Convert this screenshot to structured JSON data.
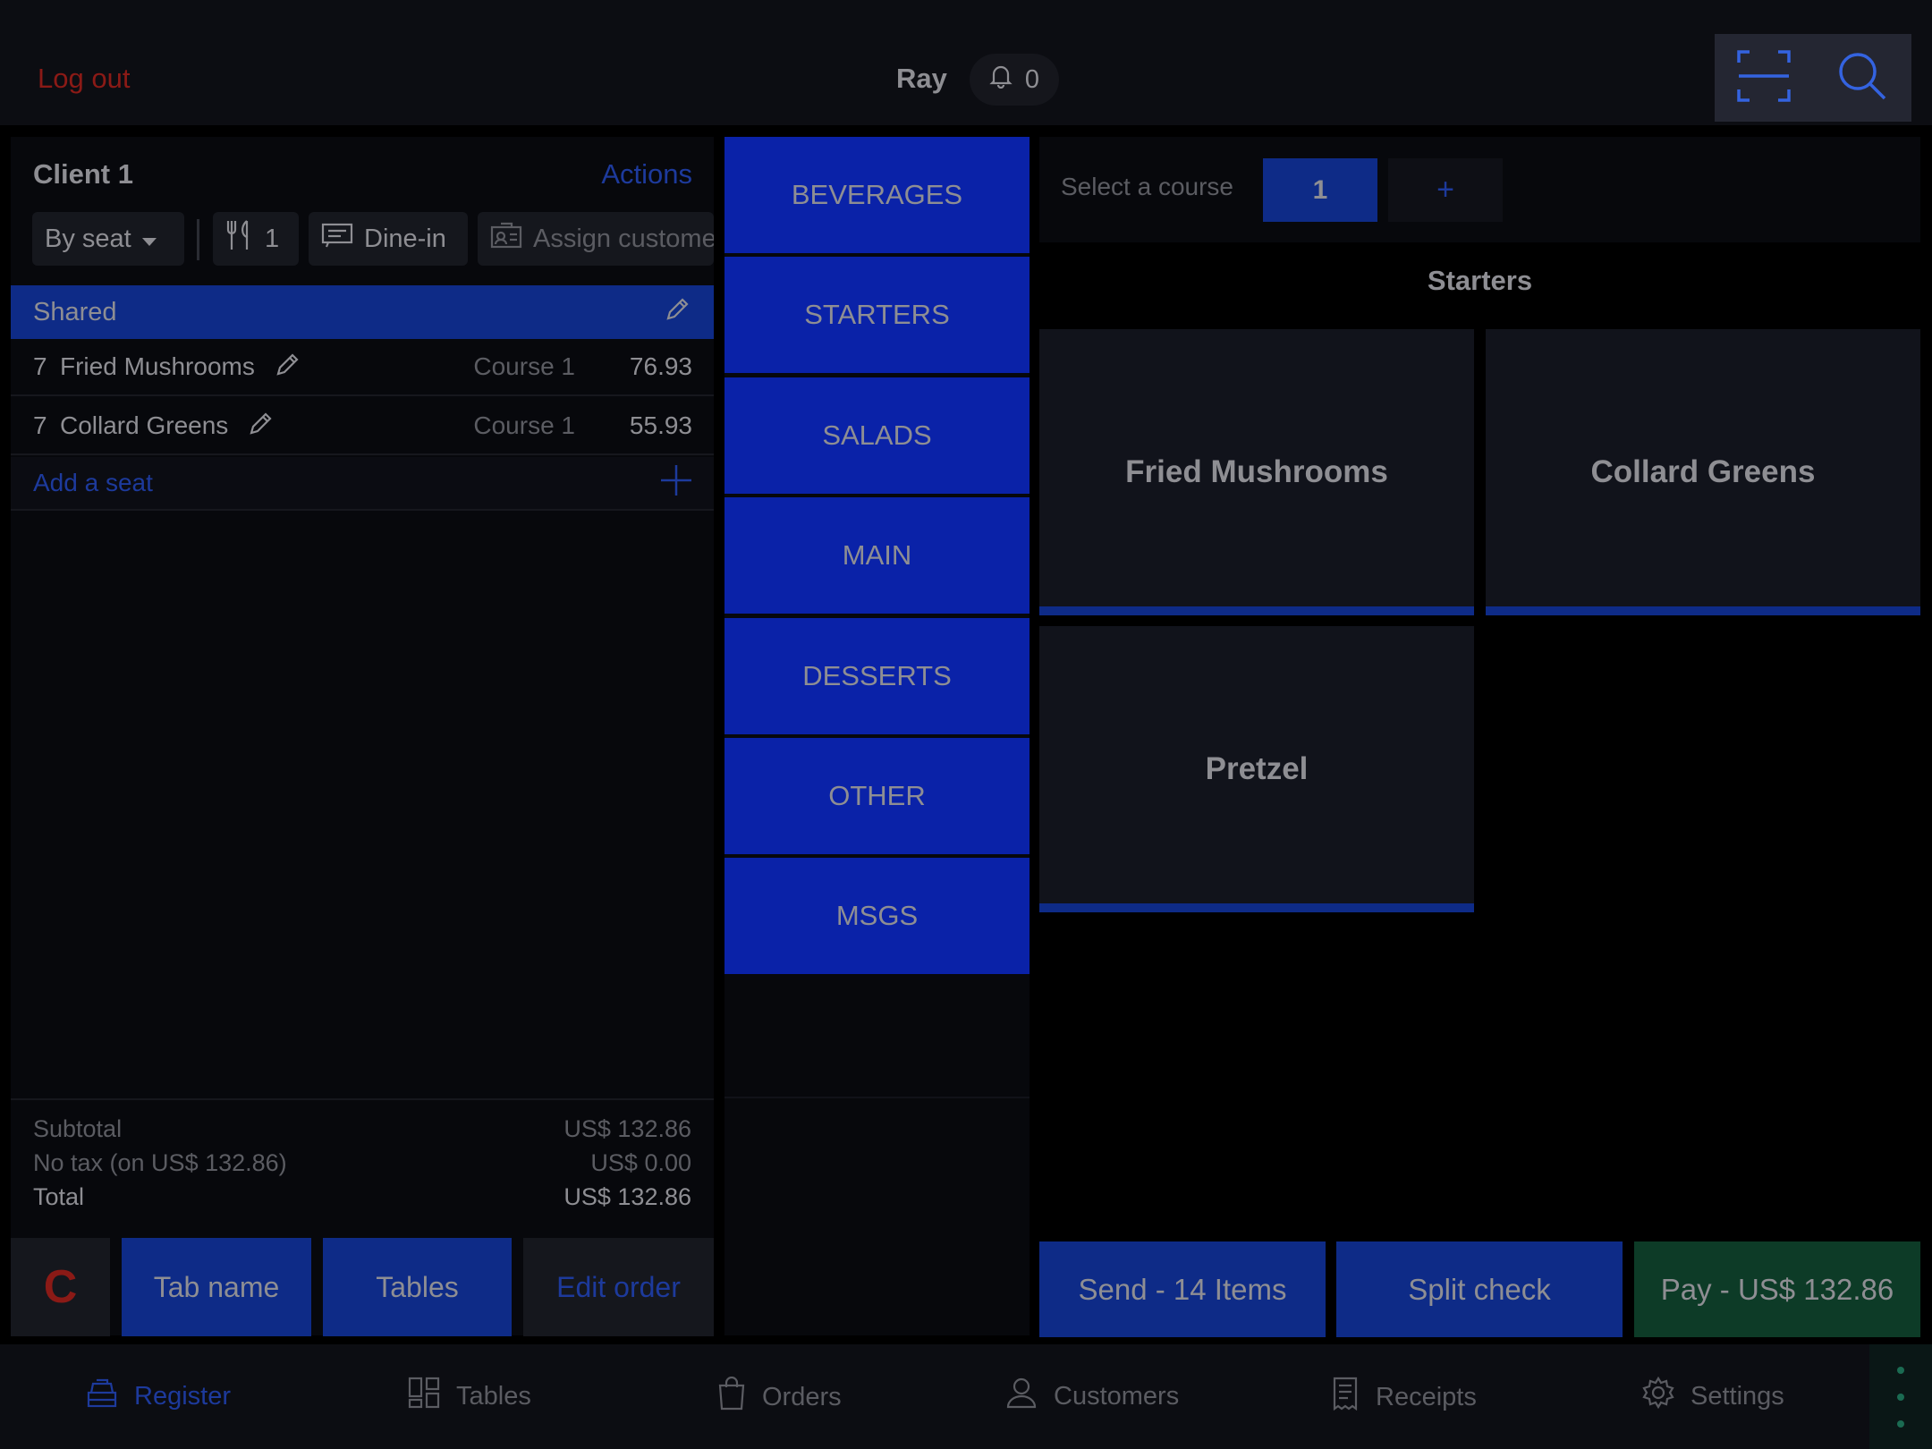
{
  "header": {
    "logout_label": "Log out",
    "user_name": "Ray",
    "notification_count": "0"
  },
  "order": {
    "client_title": "Client 1",
    "actions_label": "Actions",
    "mode_label": "By seat",
    "guests_count": "1",
    "dining_option": "Dine-in",
    "assign_customer_label": "Assign customer",
    "shared_label": "Shared",
    "items": [
      {
        "qty": "7",
        "name": "Fried Mushrooms",
        "course": "Course 1",
        "price": "76.93"
      },
      {
        "qty": "7",
        "name": "Collard Greens",
        "course": "Course 1",
        "price": "55.93"
      }
    ],
    "add_seat_label": "Add a seat"
  },
  "totals": {
    "subtotal_label": "Subtotal",
    "subtotal_value": "US$ 132.86",
    "tax_label": "No tax (on US$ 132.86)",
    "tax_value": "US$ 0.00",
    "total_label": "Total",
    "total_value": "US$ 132.86"
  },
  "order_buttons": {
    "clear_label": "C",
    "tab_name_label": "Tab name",
    "tables_label": "Tables",
    "edit_order_label": "Edit order"
  },
  "categories": [
    "BEVERAGES",
    "STARTERS",
    "SALADS",
    "MAIN",
    "DESSERTS",
    "OTHER",
    "MSGS"
  ],
  "course": {
    "label": "Select a course",
    "selected": "1",
    "add_label": "+"
  },
  "menu": {
    "section_title": "Starters",
    "items": [
      "Fried Mushrooms",
      "Collard Greens",
      "Pretzel"
    ]
  },
  "action_buttons": {
    "send_label": "Send - 14 Items",
    "split_label": "Split check",
    "pay_label": "Pay - US$ 132.86"
  },
  "tabs": [
    {
      "label": "Register",
      "icon": "register-icon",
      "active": true
    },
    {
      "label": "Tables",
      "icon": "tables-icon",
      "active": false
    },
    {
      "label": "Orders",
      "icon": "orders-icon",
      "active": false
    },
    {
      "label": "Customers",
      "icon": "customers-icon",
      "active": false
    },
    {
      "label": "Receipts",
      "icon": "receipts-icon",
      "active": false
    },
    {
      "label": "Settings",
      "icon": "settings-icon",
      "active": false
    }
  ],
  "colors": {
    "accent_blue": "#0e2b87",
    "category_blue": "#0a22a8",
    "pay_green": "#0d3b27",
    "logout_red": "#8b1a16",
    "link_blue": "#1d3a9c"
  }
}
